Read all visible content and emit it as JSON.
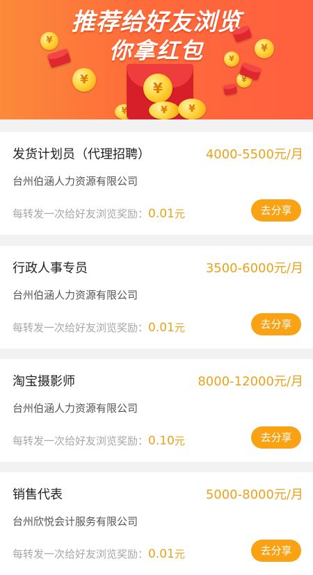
{
  "banner": {
    "line1": "推荐给好友浏览",
    "line2": "你拿红包",
    "coin_symbol": "¥"
  },
  "reward_prefix": "每转发一次给好友浏览奖励：",
  "reward_unit": "元",
  "share_label": "去分享",
  "jobs": [
    {
      "title": "发货计划员（代理招聘）",
      "salary": "4000-5500元/月",
      "company": "台州伯涵人力资源有限公司",
      "reward": "0.01"
    },
    {
      "title": "行政人事专员",
      "salary": "3500-6000元/月",
      "company": "台州伯涵人力资源有限公司",
      "reward": "0.01"
    },
    {
      "title": "淘宝摄影师",
      "salary": "8000-12000元/月",
      "company": "台州伯涵人力资源有限公司",
      "reward": "0.10"
    },
    {
      "title": "销售代表",
      "salary": "5000-8000元/月",
      "company": "台州欣悦会计服务有限公司",
      "reward": "0.01"
    }
  ],
  "colors": {
    "accent": "#f8a214",
    "salary": "#e9a21b",
    "banner": "#ff6b3a"
  }
}
